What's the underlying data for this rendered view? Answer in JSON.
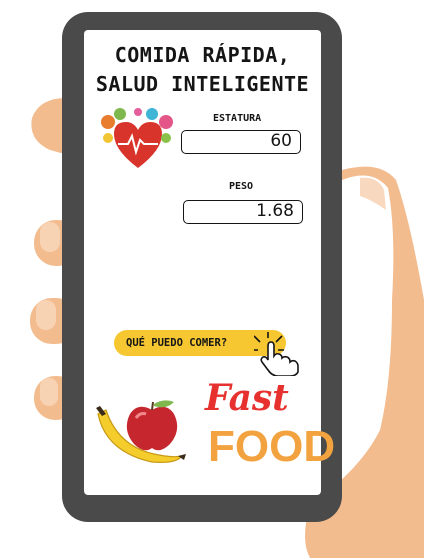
{
  "app": {
    "title_line1": "COMIDA RÁPIDA,",
    "title_line2": "SALUD INTELIGENTE"
  },
  "form": {
    "height_label": "ESTATURA",
    "height_value": "60",
    "weight_label": "PESO",
    "weight_value": "1.68"
  },
  "cta": {
    "label": "QUÉ PUEDO COMER?"
  },
  "logo": {
    "fast": "Fast",
    "food": "FOOD"
  },
  "colors": {
    "phone_frame": "#4a4a4a",
    "screen": "#ffffff",
    "skin": "#f3bc8f",
    "cta_yellow": "#f6c730",
    "logo_red": "#e6312e",
    "logo_orange": "#f2a340"
  },
  "icons": [
    "health-heart-icon",
    "pointer-hand-icon",
    "apple-icon",
    "banana-icon"
  ]
}
